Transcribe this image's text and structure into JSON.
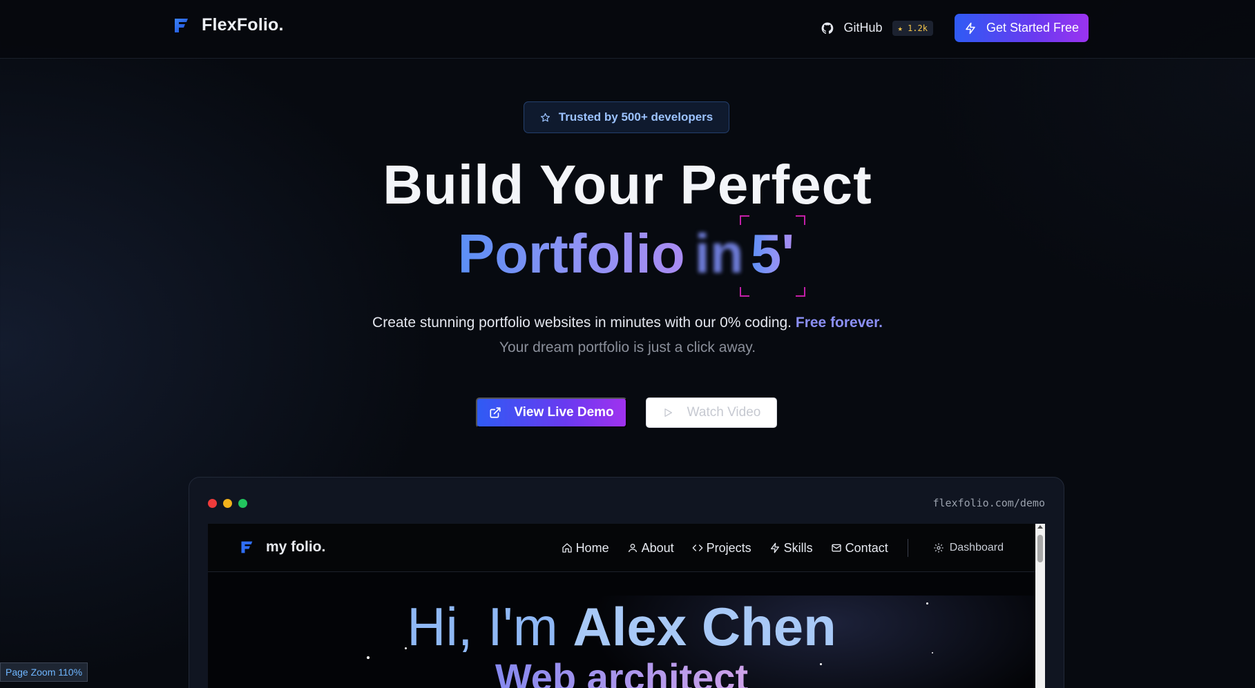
{
  "colors": {
    "accent_blue": "#2f5bf4",
    "accent_purple": "#9b33f0",
    "background": "#070a10",
    "badge_text": "#9cc3ff",
    "star_badge": "#f5c64a",
    "counter_frame": "#c21fa8"
  },
  "nav": {
    "brand": "FlexFolio.",
    "github_label": "GitHub",
    "github_stars": "★ 1.2k",
    "cta_label": "Get Started Free"
  },
  "hero": {
    "badge": "Trusted by 500+ developers",
    "title_line1": "Build Your Perfect",
    "title_word": "Portfolio",
    "title_blurred": "in",
    "title_counter": "5'",
    "subtitle": "Create stunning portfolio websites in minutes with our 0% coding.",
    "subtitle_highlight": "Free forever.",
    "tagline": "Your dream portfolio is just a click away.",
    "demo_button": "View Live Demo",
    "video_button": "Watch Video"
  },
  "preview": {
    "url": "flexfolio.com/demo",
    "site": {
      "brand": "my folio.",
      "links": [
        "Home",
        "About",
        "Projects",
        "Skills",
        "Contact"
      ],
      "dashboard": "Dashboard",
      "greeting_prefix": "Hi, I'm",
      "greeting_name": "Alex Chen",
      "role": "Web architect"
    }
  },
  "status": {
    "zoom": "Page Zoom 110%"
  }
}
